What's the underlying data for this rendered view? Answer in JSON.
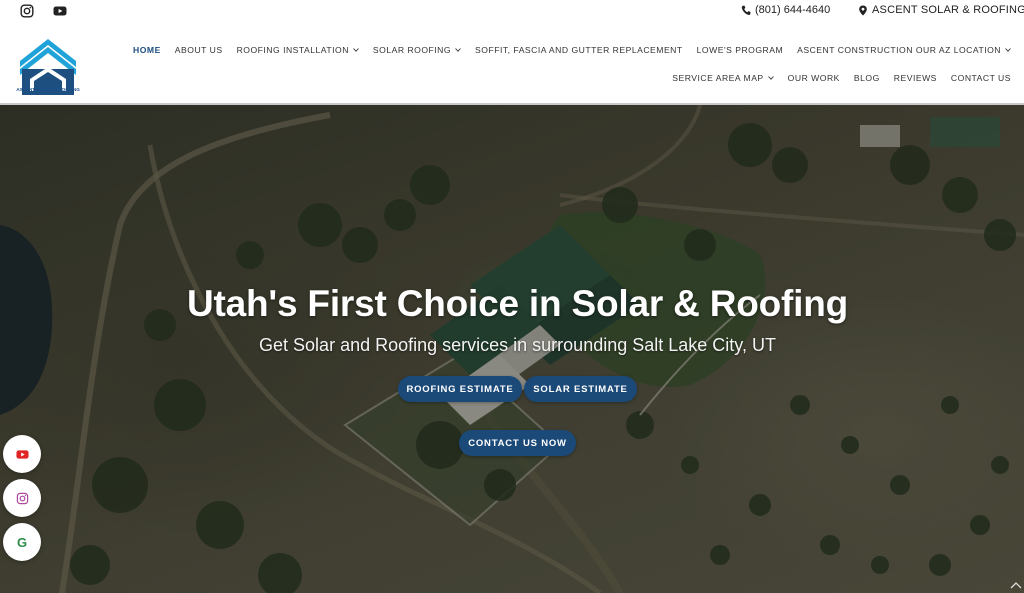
{
  "topbar": {
    "phone": "(801) 644-4640",
    "location": "ASCENT SOLAR & ROOFING",
    "social": [
      "instagram-icon",
      "youtube-icon"
    ]
  },
  "brand": {
    "logo_text": "ASCENT SOLAR & ROOFING",
    "primary_color": "#1d4f80",
    "accent_color": "#1fa3d9"
  },
  "nav": {
    "row1": [
      {
        "label": "HOME",
        "active": true,
        "dropdown": false
      },
      {
        "label": "ABOUT US",
        "dropdown": false
      },
      {
        "label": "ROOFING INSTALLATION",
        "dropdown": true
      },
      {
        "label": "SOLAR ROOFING",
        "dropdown": true
      },
      {
        "label": "SOFFIT, FASCIA AND GUTTER REPLACEMENT",
        "dropdown": false
      },
      {
        "label": "LOWE'S PROGRAM",
        "dropdown": false
      },
      {
        "label": "ASCENT CONSTRUCTION OUR AZ LOCATION",
        "dropdown": true
      }
    ],
    "row2": [
      {
        "label": "SERVICE AREA MAP",
        "dropdown": true
      },
      {
        "label": "OUR WORK",
        "dropdown": false
      },
      {
        "label": "BLOG",
        "dropdown": false
      },
      {
        "label": "REVIEWS",
        "dropdown": false
      },
      {
        "label": "CONTACT US",
        "dropdown": false
      }
    ]
  },
  "hero": {
    "title": "Utah's First Choice in Solar & Roofing",
    "subtitle": "Get Solar and Roofing services in surrounding Salt Lake City, UT",
    "buttons": {
      "roofing": "ROOFING ESTIMATE",
      "solar": "SOLAR ESTIMATE",
      "contact": "CONTACT US NOW"
    },
    "button_color": "#1c4a78"
  },
  "floating_social": {
    "youtube_color": "#e02424",
    "instagram_color": "#b04aa0",
    "google_letter": "G",
    "google_color": "#2e8b4a"
  }
}
